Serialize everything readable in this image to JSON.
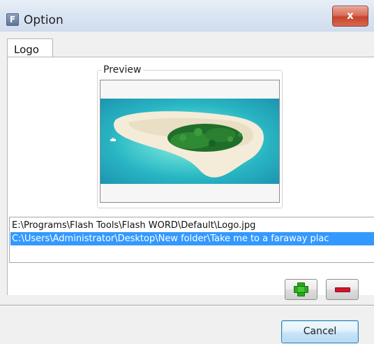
{
  "window": {
    "title": "Option",
    "app_icon_letter": "F",
    "close_glyph": "x",
    "close_icon": "close-icon"
  },
  "tabs": [
    {
      "label": "Logo",
      "selected": true
    }
  ],
  "preview": {
    "label": "Preview",
    "image_description": "tropical-island-aerial-photo"
  },
  "file_list": {
    "items": [
      {
        "text": "E:\\Programs\\Flash Tools\\Flash WORD\\Default\\Logo.jpg",
        "selected": false
      },
      {
        "text": "C:\\Users\\Administrator\\Desktop\\New folder\\Take me to a faraway plac",
        "selected": true
      }
    ]
  },
  "actions": {
    "add_icon": "plus-icon",
    "remove_icon": "minus-icon",
    "cancel_label": "Cancel"
  },
  "colors": {
    "selection": "#3399ff",
    "plus": "#2aa71e",
    "minus": "#d2152a",
    "close": "#c5432c"
  }
}
